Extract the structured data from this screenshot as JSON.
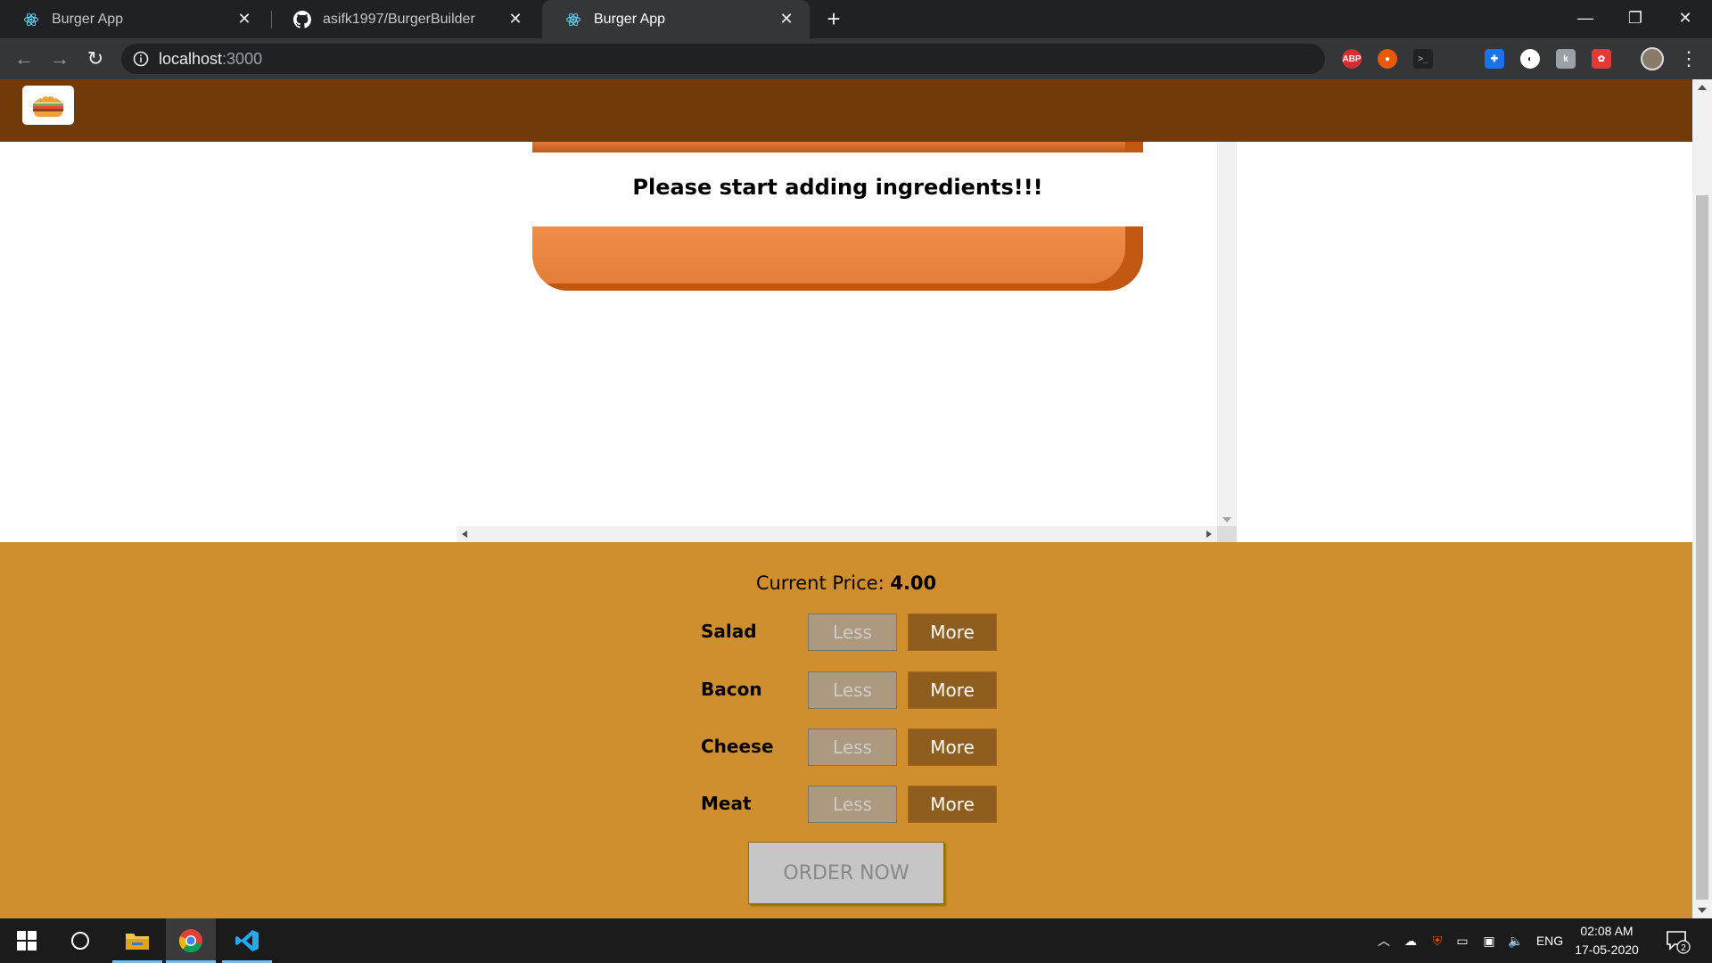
{
  "browser": {
    "tabs": [
      {
        "title": "Burger App",
        "icon": "react-icon",
        "active": false
      },
      {
        "title": "asifk1997/BurgerBuilder",
        "icon": "github-icon",
        "active": false
      },
      {
        "title": "Burger App",
        "icon": "react-icon",
        "active": true
      }
    ],
    "address": {
      "host": "localhost",
      "port": ":3000"
    },
    "extensions": [
      "adblock-plus-icon",
      "extension-icon",
      "terminal-icon",
      "extension-icon",
      "extension-icon",
      "extension-icon",
      "extension-icon"
    ],
    "window_controls": [
      "minimize",
      "restore",
      "close"
    ]
  },
  "app": {
    "logo": "burger-logo",
    "message": "Please start adding ingredients!!!",
    "price_label": "Current Price: ",
    "price_value": "4.00",
    "controls": [
      {
        "label": "Salad",
        "less": "Less",
        "more": "More"
      },
      {
        "label": "Bacon",
        "less": "Less",
        "more": "More"
      },
      {
        "label": "Cheese",
        "less": "Less",
        "more": "More"
      },
      {
        "label": "Meat",
        "less": "Less",
        "more": "More"
      }
    ],
    "order_button": "ORDER NOW",
    "colors": {
      "header": "#703b09",
      "controls_bg": "#cf8f2e",
      "more_button": "#8f5e1e",
      "less_button": "#ac9980",
      "bread": "#e27b36"
    }
  },
  "taskbar": {
    "language": "ENG",
    "time": "02:08 AM",
    "date": "17-05-2020",
    "notifications": "2"
  }
}
